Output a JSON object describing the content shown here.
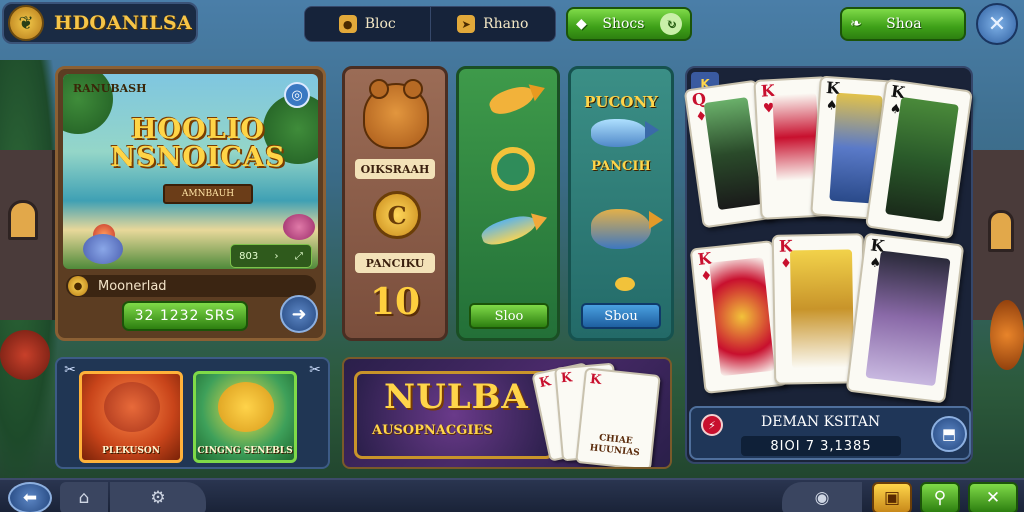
{
  "header": {
    "logo_text": "HDOANILSA",
    "tabs": [
      {
        "label": "Bloc",
        "icon": "coin-icon"
      },
      {
        "label": "Rhano",
        "icon": "fish-icon"
      }
    ],
    "shops_label": "Shocs",
    "shop2_label": "Shoa"
  },
  "featured": {
    "small_title": "RANUBASH",
    "big_title": "HOOLIO NSNOICAS",
    "ribbon": "AMNBAUH",
    "stats": "803",
    "name": "Moonerlad",
    "price": "32 1232 SRS"
  },
  "column1": {
    "label_top": "OIKSRAAH",
    "label_bottom": "PANCIKU",
    "big_number": "10"
  },
  "column2": {
    "button": "Sloo"
  },
  "column3": {
    "title": "PUCONY",
    "subtitle": "PANCIH",
    "button": "Sbou"
  },
  "card_panel": {
    "corner_label": "K",
    "cards": [
      {
        "rank": "Q",
        "suit": "♦",
        "color": "red"
      },
      {
        "rank": "K",
        "suit": "♥",
        "color": "red"
      },
      {
        "rank": "K",
        "suit": "♠",
        "color": "black"
      },
      {
        "rank": "K",
        "suit": "♠",
        "color": "black"
      },
      {
        "rank": "K",
        "suit": "♦",
        "color": "red"
      },
      {
        "rank": "K",
        "suit": "♦",
        "color": "red"
      },
      {
        "rank": "K",
        "suit": "♠",
        "color": "black"
      }
    ],
    "player_name": "DEMAN KSITAN",
    "player_value": "8IOI 7 3,1385"
  },
  "bottom_left": {
    "card1_label": "PLEKUSON",
    "card2_label": "CINGNG SENEBLS"
  },
  "banner": {
    "title": "NULBA",
    "subtitle": "AUSOPNACGIES",
    "card_rank_1": "K",
    "card_rank_2": "K",
    "card_rank_3": "K",
    "card_text": "CHIAE HUUNIAS"
  },
  "colors": {
    "accent_green": "#3ea018",
    "accent_gold": "#f6c548",
    "panel_dark": "#1a2338"
  }
}
